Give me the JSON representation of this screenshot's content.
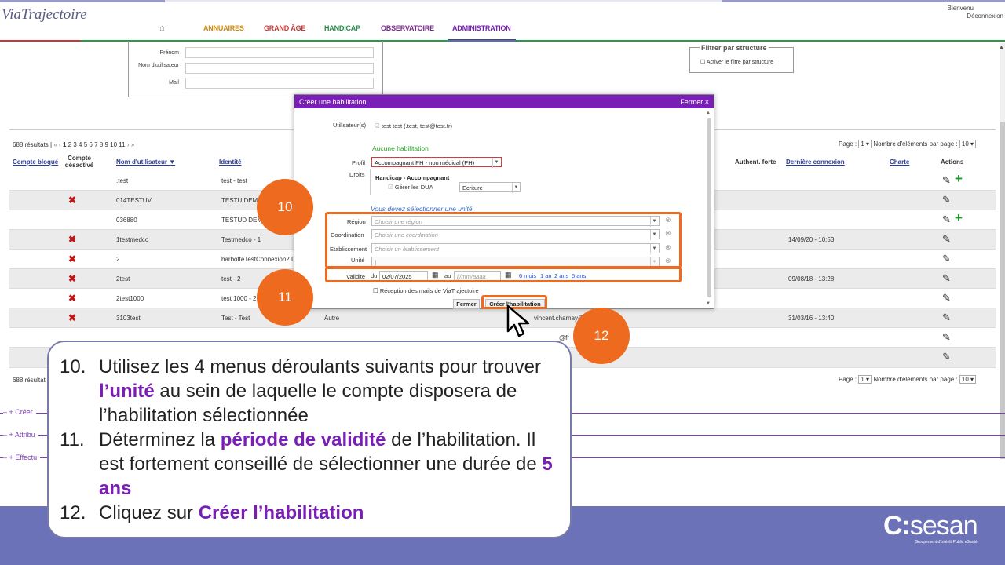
{
  "header": {
    "logo_text": "ViaTrajectoire",
    "nav": [
      "ANNUAIRES",
      "GRAND ÂGE",
      "HANDICAP",
      "OBSERVATOIRE",
      "ADMINISTRATION"
    ],
    "bienvenu": "Bienvenu",
    "deconnexion": "Déconnexion"
  },
  "search": {
    "prenom": "Prénom",
    "nom": "Nom d'utilisateur",
    "mail": "Mail"
  },
  "filter": {
    "title": "Filtrer par structure",
    "checkbox": "Activer le filtre par structure"
  },
  "table": {
    "results": "688 résultats |",
    "pages": [
      "1",
      "2",
      "3",
      "4",
      "5",
      "6",
      "7",
      "8",
      "9",
      "10",
      "11"
    ],
    "page_label": "Page :",
    "page_value": "1",
    "per_page_label": "Nombre d'éléments par page :",
    "per_page_value": "10",
    "headers": {
      "bloque": "Compte bloqué",
      "desactive": "Compte désactivé",
      "nom": "Nom d'utilisateur",
      "identite": "Identité",
      "auth": "Authent. forte",
      "derniere": "Dernière connexion",
      "charte": "Charte",
      "actions": "Actions"
    },
    "rows": [
      {
        "x": false,
        "nom": ".test",
        "id": "test - test",
        "extra": "",
        "last": "",
        "plus": true
      },
      {
        "x": true,
        "nom": "014TESTUV",
        "id": "TESTU DEMO",
        "extra": "",
        "last": "",
        "plus": false
      },
      {
        "x": false,
        "nom": "036880",
        "id": "TESTUD DEMO",
        "extra": "",
        "last": "",
        "plus": true
      },
      {
        "x": true,
        "nom": "1testmedco",
        "id": "Testmedco - 1",
        "extra": "",
        "last": "14/09/20 - 10:53",
        "plus": false
      },
      {
        "x": true,
        "nom": "2",
        "id": "barbotteTestConnexion2 D",
        "extra": "",
        "last": "",
        "plus": false
      },
      {
        "x": true,
        "nom": "2test",
        "id": "test - 2",
        "extra": "",
        "last": "09/08/18 - 13:28",
        "plus": false
      },
      {
        "x": true,
        "nom": "2test1000",
        "id": "test 1000 - 2",
        "extra": "",
        "last": "",
        "plus": false
      },
      {
        "x": true,
        "nom": "3103test",
        "id": "Test - Test",
        "extra": "Autre",
        "email": "vincent.charnay@",
        "last": "31/03/16 - 13:40",
        "plus": false
      },
      {
        "x": true,
        "nom": "",
        "id": "",
        "extra": "",
        "email": "@fr",
        "last": "",
        "plus": false
      },
      {
        "x": false,
        "nom": "",
        "id": "",
        "extra": "",
        "last": "",
        "plus": false
      }
    ],
    "bottom_results": "688 résultat"
  },
  "sections": [
    "+ Créer",
    "+ Attribu",
    "+ Effectu"
  ],
  "modal": {
    "title": "Créer une habilitation",
    "close": "Fermer ×",
    "users_label": "Utilisateur(s)",
    "users_value": "test test (.test, test@test.fr)",
    "aucune": "Aucune habilitation",
    "profil_label": "Profil",
    "profil_value": "Accompagnant PH - non médical (PH)",
    "droits_label": "Droits",
    "droits_title": "Handicap - Accompagnant",
    "gerer": "Gérer les DUA",
    "gerer_value": "Ecriture",
    "warning": "Vous devez sélectionner une unité.",
    "region_label": "Région",
    "region_ph": "Choisir une région",
    "coord_label": "Coordination",
    "coord_ph": "Choisir une coordination",
    "etab_label": "Etablissement",
    "etab_ph": "Choisir un établissement",
    "unite_label": "Unité",
    "validite_label": "Validité",
    "du": "du",
    "date_from": "02/07/2025",
    "au": "au",
    "date_to_ph": "jj/mm/aaaa",
    "durations": [
      "6 mois",
      "1 an",
      "2 ans",
      "5 ans"
    ],
    "reception": "Réception des mails de ViaTrajectoire",
    "fermer_btn": "Fermer",
    "creer_btn": "Créer l'habilitation"
  },
  "steps": [
    "10",
    "11",
    "12"
  ],
  "instructions": {
    "s10_num": "10.",
    "s10_a": "Utilisez les 4 menus déroulants suivants pour trouver ",
    "s10_b": "l’unité",
    "s10_c": " au sein de laquelle le compte disposera de l’habilitation sélectionnée",
    "s11_num": "11.",
    "s11_a": "Déterminez la ",
    "s11_b": "période de validité",
    "s11_c": " de l’habilitation. Il est fortement conseillé de sélectionner une durée de ",
    "s11_d": "5 ans",
    "s12_num": "12.",
    "s12_a": "Cliquez sur ",
    "s12_b": "Créer l’habilitation"
  },
  "brand": {
    "name": "sesan",
    "tagline": "Groupement d'Intérêt Public eSanté"
  },
  "colors": {
    "accent": "#7a1fb5",
    "orange": "#ed6a1f",
    "footer": "#6b72b7"
  }
}
